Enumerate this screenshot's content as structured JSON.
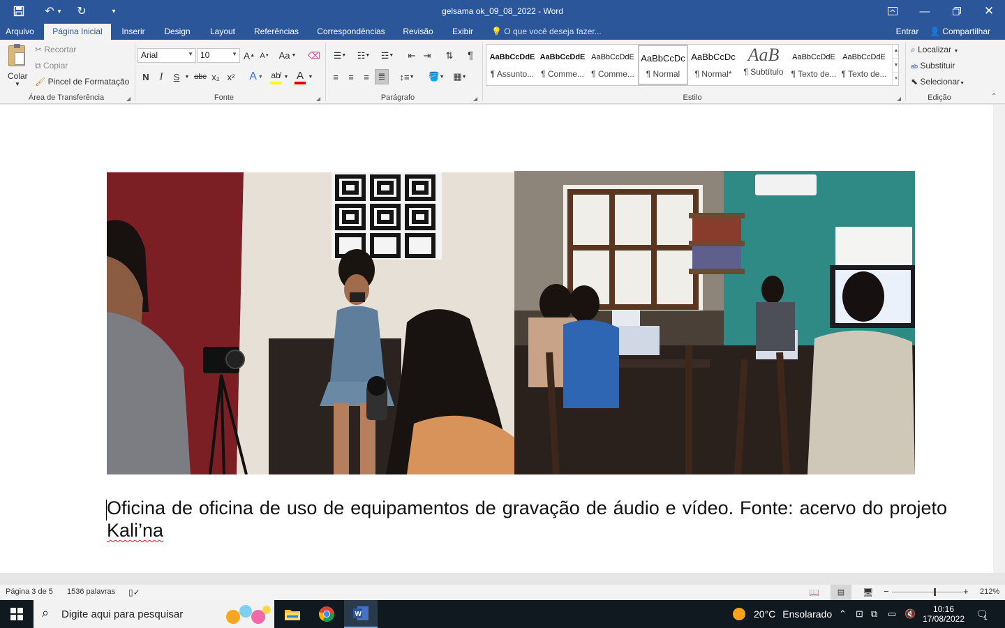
{
  "window": {
    "title": "gelsama ok_09_08_2022 - Word"
  },
  "tabs": [
    {
      "label": "Arquivo"
    },
    {
      "label": "Página Inicial"
    },
    {
      "label": "Inserir"
    },
    {
      "label": "Design"
    },
    {
      "label": "Layout"
    },
    {
      "label": "Referências"
    },
    {
      "label": "Correspondências"
    },
    {
      "label": "Revisão"
    },
    {
      "label": "Exibir"
    }
  ],
  "tell_me": "O que você deseja fazer...",
  "account": {
    "signin": "Entrar",
    "share": "Compartilhar"
  },
  "clipboard": {
    "paste": "Colar",
    "cut": "Recortar",
    "copy": "Copiar",
    "format_painter": "Pincel de Formatação",
    "group": "Área de Transferência"
  },
  "font": {
    "name": "Arial",
    "size": "10",
    "bold": "N",
    "italic": "I",
    "underline": "S",
    "strike": "abc",
    "sub": "x₂",
    "sup": "x²",
    "case": "Aa",
    "grow": "A",
    "shrink": "A",
    "group": "Fonte",
    "highlight_color": "#ffff00",
    "font_color": "#e00000"
  },
  "paragraph": {
    "group": "Parágrafo"
  },
  "styles": {
    "group": "Estilo",
    "items": [
      {
        "preview": "AaBbCcDdE",
        "name": "¶ Assunto..."
      },
      {
        "preview": "AaBbCcDdE",
        "name": "¶ Comme..."
      },
      {
        "preview": "AaBbCcDdE",
        "name": "¶ Comme..."
      },
      {
        "preview": "AaBbCcDc",
        "name": "¶ Normal"
      },
      {
        "preview": "AaBbCcDc",
        "name": "¶ Normal*"
      },
      {
        "preview": "AaB",
        "name": "¶ Subtítulo"
      },
      {
        "preview": "AaBbCcDdE",
        "name": "¶ Texto de..."
      },
      {
        "preview": "AaBbCcDdE",
        "name": "¶ Texto de..."
      }
    ]
  },
  "editing": {
    "find": "Localizar",
    "replace": "Substituir",
    "select": "Selecionar",
    "group": "Edição"
  },
  "document": {
    "caption_main": "Oficina de oficina de uso de equipamentos de gravação de áudio e vídeo. Fonte: acervo do projeto ",
    "caption_last": "Kali’na"
  },
  "status": {
    "page": "Página 3 de 5",
    "words": "1536 palavras",
    "zoom": "212%"
  },
  "taskbar": {
    "search_placeholder": "Digite aqui para pesquisar",
    "weather_temp": "20°C",
    "weather_desc": "Ensolarado",
    "time": "10:16",
    "date": "17/08/2022",
    "notifications": "1"
  }
}
